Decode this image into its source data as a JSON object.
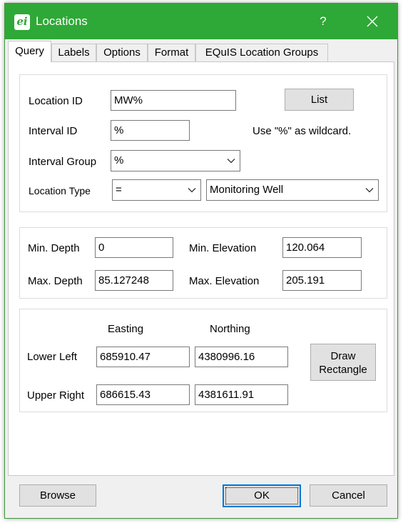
{
  "window": {
    "title": "Locations",
    "help": "?",
    "app_icon": "ei"
  },
  "tabs": [
    "Query",
    "Labels",
    "Options",
    "Format",
    "EQuIS Location Groups"
  ],
  "filter": {
    "location_id_label": "Location ID",
    "location_id_value": "MW%",
    "list_button": "List",
    "interval_id_label": "Interval ID",
    "interval_id_value": "%",
    "wildcard_hint": "Use \"%\" as wildcard.",
    "interval_group_label": "Interval Group",
    "interval_group_value": "%",
    "location_type_label": "Location Type",
    "location_type_operator": "=",
    "location_type_value": "Monitoring Well"
  },
  "depth": {
    "min_depth_label": "Min. Depth",
    "min_depth_value": "0",
    "max_depth_label": "Max. Depth",
    "max_depth_value": "85.127248",
    "min_elev_label": "Min. Elevation",
    "min_elev_value": "120.064",
    "max_elev_label": "Max. Elevation",
    "max_elev_value": "205.191"
  },
  "extent": {
    "easting_header": "Easting",
    "northing_header": "Northing",
    "lower_left_label": "Lower Left",
    "lower_left_easting": "685910.47",
    "lower_left_northing": "4380996.16",
    "upper_right_label": "Upper Right",
    "upper_right_easting": "686615.43",
    "upper_right_northing": "4381611.91",
    "draw_line1": "Draw",
    "draw_line2": "Rectangle"
  },
  "footer": {
    "browse": "Browse",
    "ok": "OK",
    "cancel": "Cancel"
  },
  "colors": {
    "titlebar": "#2ea836",
    "accent": "#0078d7"
  }
}
